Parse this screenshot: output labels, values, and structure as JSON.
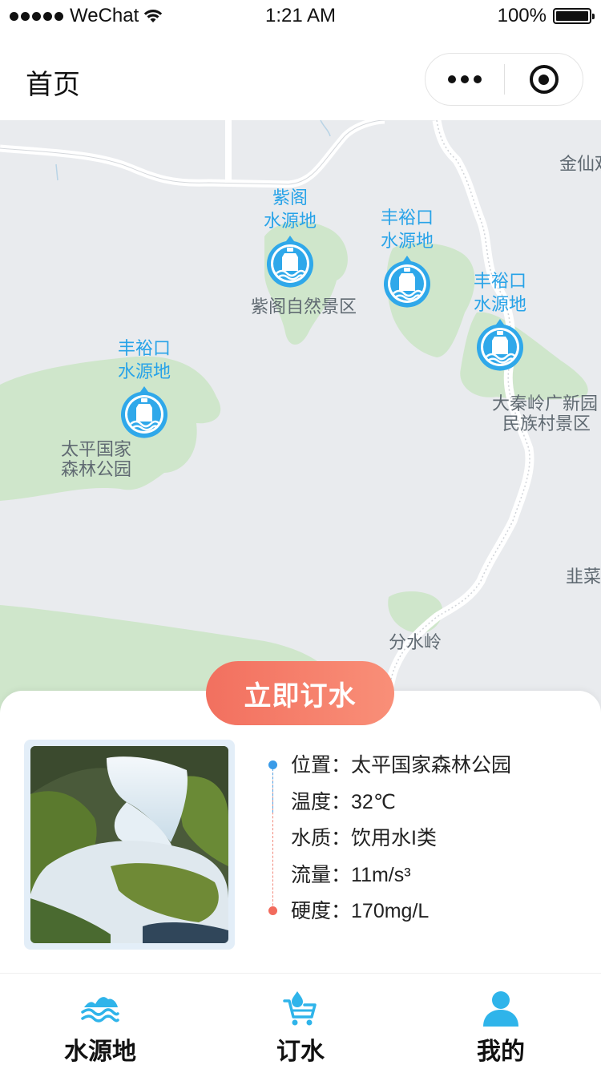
{
  "status_bar": {
    "carrier": "WeChat",
    "time": "1:21 AM",
    "battery": "100%"
  },
  "nav": {
    "title": "首页"
  },
  "map": {
    "places": {
      "jinxian": "金仙观",
      "zige": "紫阁自然景区",
      "taiping_line1": "太平国家",
      "taiping_line2": "森林公园",
      "daqinling_line1": "大秦岭广新园",
      "daqinling_line2": "民族村景区",
      "jiecai": "韭菜",
      "fenshuiling": "分水岭"
    },
    "markers": [
      {
        "line1": "紫阁",
        "line2": "水源地"
      },
      {
        "line1": "丰裕口",
        "line2": "水源地"
      },
      {
        "line1": "丰裕口",
        "line2": "水源地"
      },
      {
        "line1": "丰裕口",
        "line2": "水源地"
      }
    ]
  },
  "sheet": {
    "order_button": "立即订水",
    "info": [
      {
        "key": "位置：",
        "value": "太平国家森林公园"
      },
      {
        "key": "温度：",
        "value": "32℃"
      },
      {
        "key": "水质：",
        "value": "饮用水I类"
      },
      {
        "key": "流量：",
        "value": "11m/s³"
      },
      {
        "key": "硬度：",
        "value": "170mg/L"
      }
    ]
  },
  "tabs": [
    {
      "label": "水源地",
      "icon": "mountain-water-icon"
    },
    {
      "label": "订水",
      "icon": "water-cart-icon"
    },
    {
      "label": "我的",
      "icon": "user-icon"
    }
  ],
  "colors": {
    "accent_blue": "#28a3e8",
    "order_red": "#f2705f",
    "map_bg": "#e9ebee",
    "park_green": "#cfe6cb"
  }
}
